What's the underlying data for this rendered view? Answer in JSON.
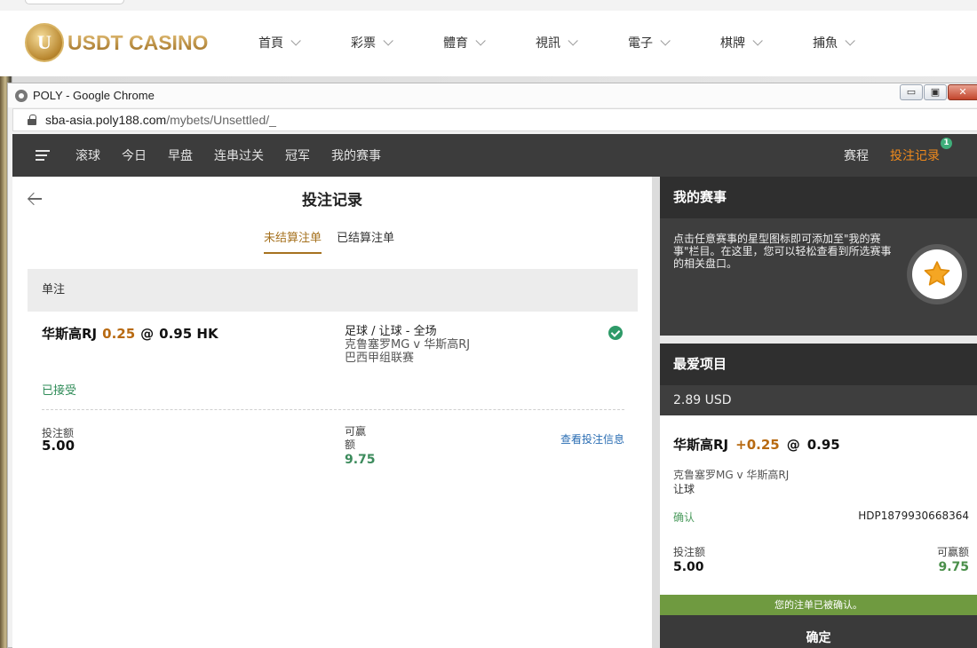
{
  "site": {
    "logo_text": "USDT CASINO",
    "logo_badge": "U",
    "nav": [
      "首頁",
      "彩票",
      "體育",
      "視訊",
      "電子",
      "棋牌",
      "捕魚"
    ]
  },
  "browser": {
    "window_title": "POLY - Google Chrome",
    "url_host": "sba-asia.poly188.com",
    "url_path": "/mybets/Unsettled/_",
    "win_buttons": [
      "▭",
      "▣",
      "✕"
    ]
  },
  "app_nav": {
    "left": [
      "滚球",
      "今日",
      "早盘",
      "连串过关",
      "冠军",
      "我的赛事"
    ],
    "schedule": "赛程",
    "bet_record": "投注记录",
    "badge_count": "1",
    "accent_color": "#f08a1c"
  },
  "bets_page": {
    "title": "投注记录",
    "tabs": [
      "未结算注单",
      "已结算注单"
    ],
    "section": "单注",
    "bet": {
      "selection": "华斯高RJ",
      "handicap": "0.25",
      "at": "@",
      "odds": "0.95 HK",
      "market": "足球 / 让球 - 全场",
      "match": "克鲁塞罗MG v 华斯高RJ",
      "league": "巴西甲组联赛",
      "status": "已接受",
      "stake_label": "投注额",
      "stake": "5.00",
      "win_label": "可赢额",
      "win": "9.75",
      "view_info": "查看投注信息"
    }
  },
  "sidebar": {
    "my_events_title": "我的赛事",
    "my_events_text": "点击任意赛事的星型图标即可添加至\"我的赛事\"栏目。在这里，您可以轻松查看到所选赛事的相关盘口。",
    "fav_title": "最爱项目",
    "balance": "2.89 USD",
    "slip": {
      "selection": "华斯高RJ",
      "handicap": "+0.25",
      "at": "@",
      "odds": "0.95",
      "match": "克鲁塞罗MG v 华斯高RJ",
      "market": "让球",
      "status": "确认",
      "ticket": "HDP1879930668364",
      "stake_label": "投注额",
      "stake": "5.00",
      "win_label": "可赢额",
      "win": "9.75"
    },
    "confirm_message": "您的注单已被确认。",
    "ok_button": "确定"
  }
}
